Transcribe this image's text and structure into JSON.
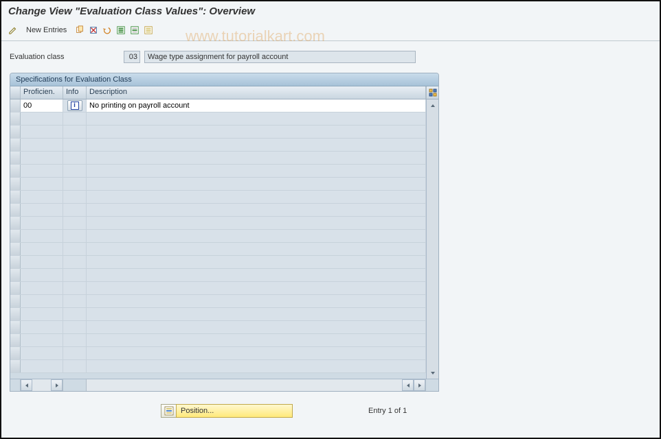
{
  "title": "Change View \"Evaluation Class Values\": Overview",
  "watermark": "www.tutorialkart.com",
  "toolbar": {
    "new_entries": "New Entries"
  },
  "form": {
    "eval_class_label": "Evaluation class",
    "eval_class_code": "03",
    "eval_class_desc": "Wage type assignment for payroll account"
  },
  "groupbox_title": "Specifications for Evaluation Class",
  "columns": {
    "proficien": "Proficien.",
    "info": "Info",
    "description": "Description"
  },
  "rows": [
    {
      "proficien": "00",
      "info": "i",
      "description": "No printing on payroll account"
    }
  ],
  "footer": {
    "position_label": "Position...",
    "entry_text": "Entry 1 of 1"
  }
}
